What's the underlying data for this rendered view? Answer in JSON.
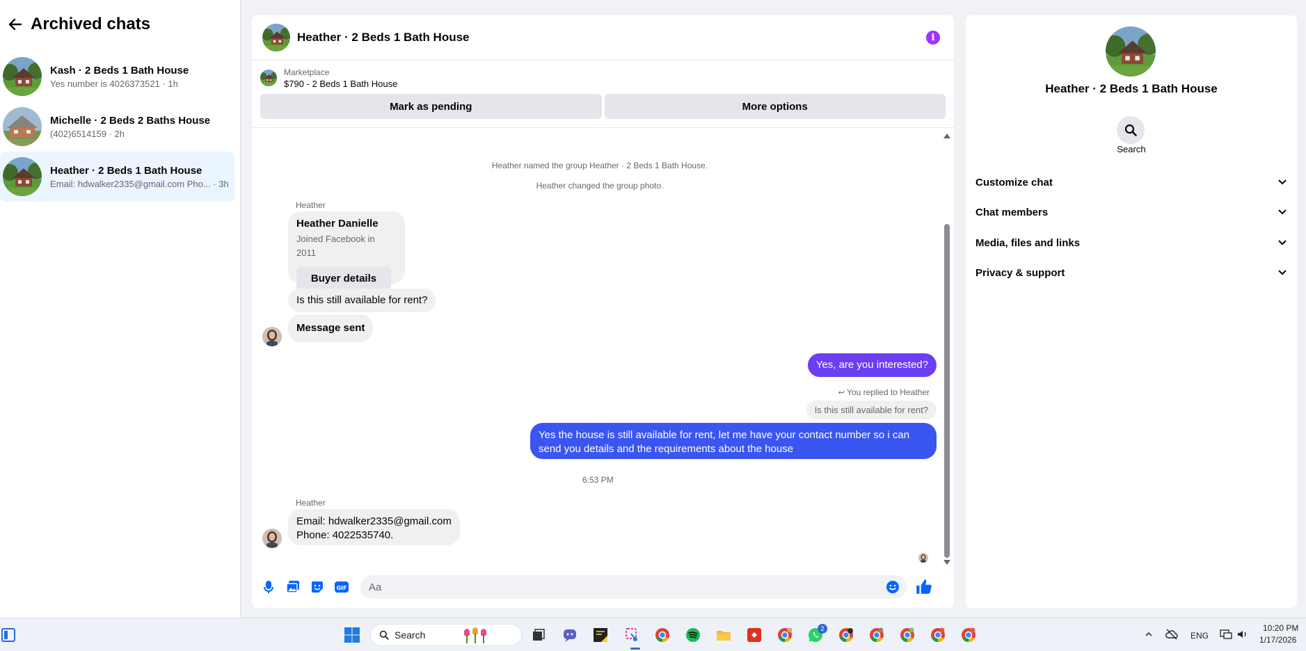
{
  "sidebar": {
    "title": "Archived chats",
    "chats": [
      {
        "name": "Kash · 2 Beds 1 Bath House",
        "preview": "Yes number is 4026373521 · 1h"
      },
      {
        "name": "Michelle · 2 Beds 2 Baths House",
        "preview": "(402)6514159 · 2h"
      },
      {
        "name": "Heather · 2 Beds 1 Bath House",
        "preview": "Email: hdwalker2335@gmail.com Pho... · 3h"
      }
    ]
  },
  "chat": {
    "title": "Heather · 2 Beds 1 Bath House",
    "marketplace": {
      "label": "Marketplace",
      "listing": "$790 - 2 Beds 1 Bath House",
      "pending_button": "Mark as pending",
      "options_button": "More options"
    },
    "system_messages": [
      "Heather named the group Heather · 2 Beds 1 Bath House.",
      "Heather changed the group photo."
    ],
    "sender_name": "Heather",
    "profile_card": {
      "name": "Heather Danielle",
      "joined": "Joined Facebook in 2011",
      "button": "Buyer details"
    },
    "incoming_1": "Is this still available for rent?",
    "incoming_2": "Message sent",
    "outgoing_1": "Yes, are you interested?",
    "reply_note": "You replied to Heather",
    "reply_quote": "Is this still available for rent?",
    "outgoing_2": "Yes the house is still available for rent, let me have your contact number so i can send you details and the requirements about the house",
    "timestamp": "6:53 PM",
    "incoming_3_line1": "Email: hdwalker2335@gmail.com",
    "incoming_3_line2": "Phone: 4022535740.",
    "composer_placeholder": "Aa"
  },
  "info_panel": {
    "name": "Heather · 2 Beds 1 Bath House",
    "search_label": "Search",
    "sections": [
      "Customize chat",
      "Chat members",
      "Media, files and links",
      "Privacy & support"
    ]
  },
  "taskbar": {
    "search_label": "Search",
    "language": "ENG",
    "time": "10:20 PM",
    "date": "1/17/2026",
    "whatsapp_badge": "2"
  },
  "colors": {
    "accent_blue": "#3a55f0",
    "accent_purple": "#6b3ef2",
    "info_icon": "#a033ff",
    "active_chat_bg": "#ebf5ff"
  },
  "icons": [
    "back-arrow-icon",
    "info-icon",
    "microphone-icon",
    "photo-icon",
    "sticker-icon",
    "gif-icon",
    "emoji-icon",
    "like-icon",
    "search-icon",
    "chevron-down-icon",
    "reply-icon",
    "windows-start-icon"
  ]
}
